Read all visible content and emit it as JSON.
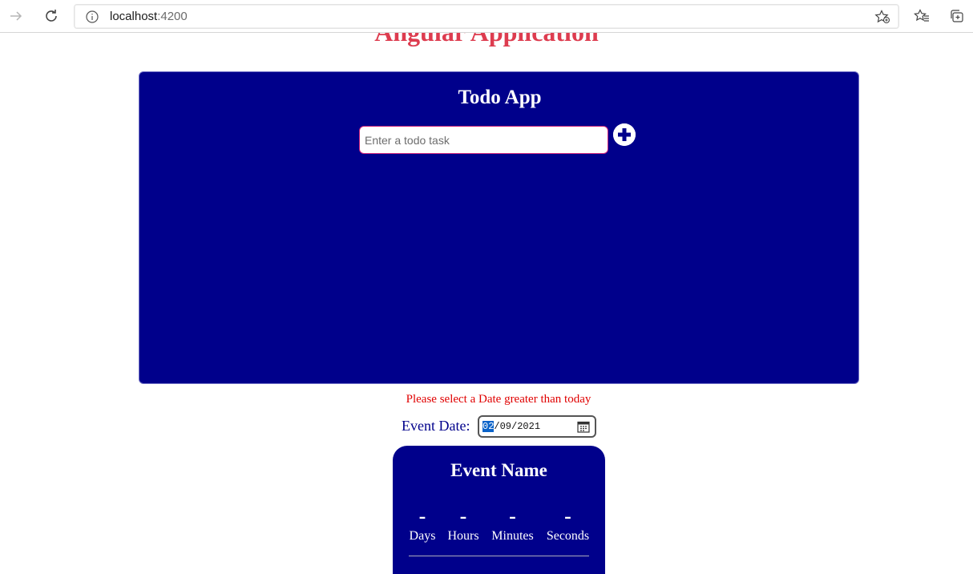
{
  "browser": {
    "url_host": "localhost",
    "url_port": ":4200"
  },
  "page": {
    "title": "Angular Application"
  },
  "todo": {
    "title": "Todo App",
    "input_placeholder": "Enter a todo task",
    "input_value": ""
  },
  "event": {
    "error_message": "Please select a Date greater than today",
    "date_label": "Event Date:",
    "date_month": "02",
    "date_rest": "/09/2021",
    "card_title": "Event Name",
    "countdown": [
      {
        "value": "-",
        "label": "Days"
      },
      {
        "value": "-",
        "label": "Hours"
      },
      {
        "value": "-",
        "label": "Minutes"
      },
      {
        "value": "-",
        "label": "Seconds"
      }
    ]
  },
  "colors": {
    "card_bg": "#00008b",
    "title_red": "#dc3545",
    "error_red": "#e00000"
  }
}
